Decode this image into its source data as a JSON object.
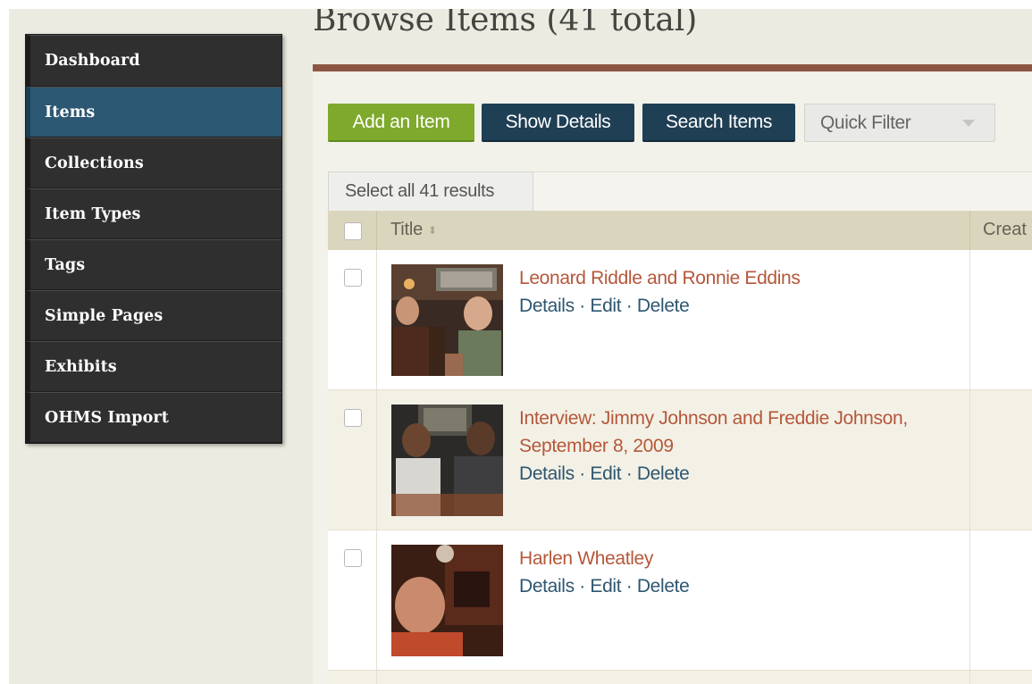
{
  "page": {
    "title": "Browse Items (41 total)"
  },
  "sidebar": {
    "items": [
      {
        "label": "Dashboard",
        "active": false
      },
      {
        "label": "Items",
        "active": true
      },
      {
        "label": "Collections",
        "active": false
      },
      {
        "label": "Item Types",
        "active": false
      },
      {
        "label": "Tags",
        "active": false
      },
      {
        "label": "Simple Pages",
        "active": false
      },
      {
        "label": "Exhibits",
        "active": false
      },
      {
        "label": "OHMS Import",
        "active": false
      }
    ]
  },
  "toolbar": {
    "add_label": "Add an Item",
    "show_details_label": "Show Details",
    "search_label": "Search Items",
    "quick_filter_label": "Quick Filter"
  },
  "table": {
    "select_all_label": "Select all 41 results",
    "columns": {
      "title": "Title",
      "creator": "Creat"
    },
    "rows": [
      {
        "title": "Leonard Riddle and Ronnie Eddins",
        "details": "Details",
        "edit": "Edit",
        "delete": "Delete",
        "sep": "·"
      },
      {
        "title": "Interview: Jimmy Johnson and Freddie Johnson, September 8, 2009",
        "details": "Details",
        "edit": "Edit",
        "delete": "Delete",
        "sep": "·"
      },
      {
        "title": "Harlen Wheatley",
        "details": "Details",
        "edit": "Edit",
        "delete": "Delete",
        "sep": "·"
      }
    ]
  },
  "colors": {
    "sidebar_bg": "#2f2f2f",
    "sidebar_active": "#2c5873",
    "add_button": "#7ea92c",
    "dark_button": "#1f3f55",
    "title_link": "#b5573a",
    "action_link": "#2e5670",
    "title_rule": "#8b5641"
  }
}
